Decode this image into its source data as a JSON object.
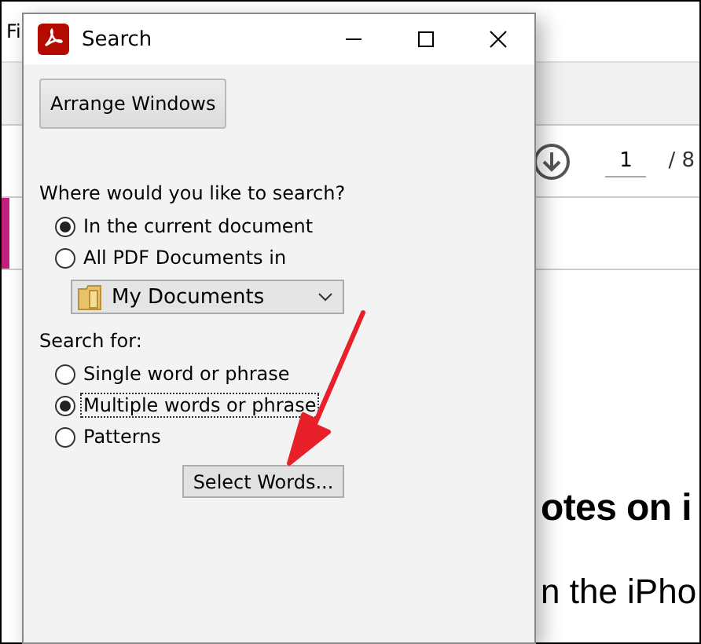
{
  "app": {
    "menu": [
      "Fi"
    ],
    "page_field": {
      "value": "1"
    },
    "page_total": "/ 8",
    "doc_lines": [
      {
        "kind": "heading",
        "text": "otes on i"
      },
      {
        "kind": "body",
        "text": "n the iPho"
      }
    ]
  },
  "dialog": {
    "title": "Search",
    "arrange_button": "Arrange Windows",
    "where_label": "Where would you like to search?",
    "where_options": [
      {
        "label": "In the current document",
        "selected": true
      },
      {
        "label": "All PDF Documents in",
        "selected": false
      }
    ],
    "folder_select": {
      "value": "My Documents"
    },
    "search_for_label": "Search for:",
    "search_options": [
      {
        "label": "Single word or phrase",
        "selected": false,
        "focused": false
      },
      {
        "label": "Multiple words or phrase",
        "selected": true,
        "focused": true
      },
      {
        "label": "Patterns",
        "selected": false,
        "focused": false
      }
    ],
    "select_words_button": "Select Words..."
  }
}
